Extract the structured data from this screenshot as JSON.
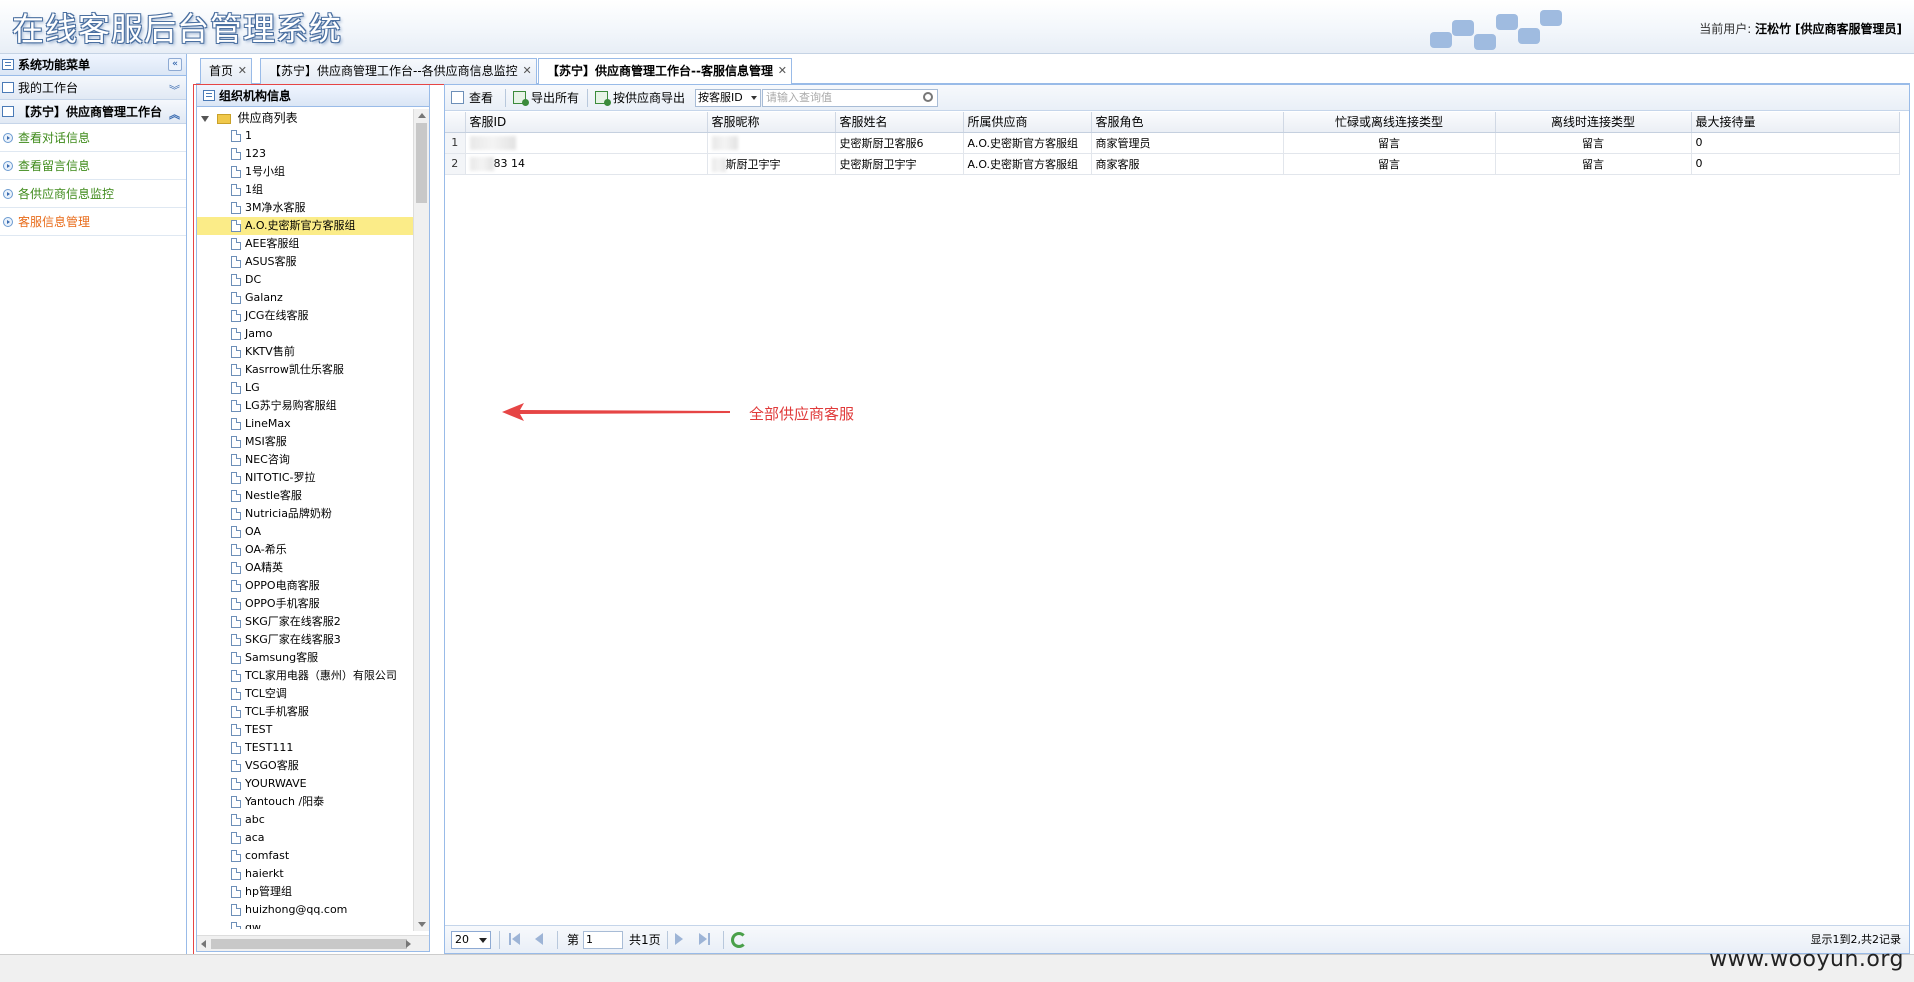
{
  "header": {
    "title": "在线客服后台管理系统",
    "user_label": "当前用户:",
    "user_name": "汪松竹",
    "user_role": "[供应商客服管理员]"
  },
  "sidebar": {
    "title": "系统功能菜单",
    "collapse_icon": "double-chevron-left-icon",
    "my_work": "我的工作台",
    "group_title": "【苏宁】供应商管理工作台",
    "items": [
      {
        "label": "查看对话信息"
      },
      {
        "label": "查看留言信息"
      },
      {
        "label": "各供应商信息监控"
      },
      {
        "label": "客服信息管理"
      }
    ]
  },
  "tabs": [
    {
      "label": "首页"
    },
    {
      "label": "【苏宁】供应商管理工作台--各供应商信息监控"
    },
    {
      "label": "【苏宁】供应商管理工作台--客服信息管理"
    }
  ],
  "org_panel": {
    "title": "组织机构信息",
    "root": "供应商列表",
    "nodes": [
      "1",
      "123",
      "1号小组",
      "1组",
      "3M净水客服",
      "A.O.史密斯官方客服组",
      "AEE客服组",
      "ASUS客服",
      "DC",
      "Galanz",
      "JCG在线客服",
      "Jamo",
      "KKTV售前",
      "Kasrrow凯仕乐客服",
      "LG",
      "LG苏宁易购客服组",
      "LineMax",
      "MSI客服",
      "NEC咨询",
      "NITOTIC-罗拉",
      "Nestle客服",
      "Nutricia品牌奶粉",
      "OA",
      "OA-希乐",
      "OA精英",
      "OPPO电商客服",
      "OPPO手机客服",
      "SKG厂家在线客服2",
      "SKG厂家在线客服3",
      "Samsung客服",
      "TCL家用电器（惠州）有限公司",
      "TCL空调",
      "TCL手机客服",
      "TEST",
      "TEST111",
      "VSGO客服",
      "YOURWAVE",
      "Yantouch /阳泰",
      "abc",
      "aca",
      "comfast",
      "haierkt",
      "hp管理组",
      "huizhong@qq.com",
      "qw"
    ],
    "selected": "A.O.史密斯官方客服组"
  },
  "toolbar": {
    "view": "查看",
    "export_all": "导出所有",
    "export_by_supplier": "按供应商导出",
    "search_field": "按客服ID",
    "search_placeholder": "请输入查询值"
  },
  "grid": {
    "columns": [
      "客服ID",
      "客服昵称",
      "客服姓名",
      "所属供应商",
      "客服角色",
      "忙碌或离线连接类型",
      "离线时连接类型",
      "最大接待量"
    ],
    "rows": [
      {
        "no": "1",
        "id": "",
        "nick": "",
        "name": "史密斯厨卫客服6",
        "supplier": "A.O.史密斯官方客服组",
        "role": "商家管理员",
        "busy": "留言",
        "offline": "留言",
        "max": "0"
      },
      {
        "no": "2",
        "id": "83  14",
        "nick": "斯厨卫宇宇",
        "name": "史密斯厨卫宇宇",
        "supplier": "A.O.史密斯官方客服组",
        "role": "商家客服",
        "busy": "留言",
        "offline": "留言",
        "max": "0"
      }
    ]
  },
  "pager": {
    "page_size": "20",
    "page_prefix": "第",
    "page_value": "1",
    "page_total": "共1页",
    "info": "显示1到2,共2记录"
  },
  "annotation": "全部供应商客服",
  "watermark": "www.wooyun.org",
  "colors": {
    "accent": "#99bbe8",
    "annotation": "#e64545",
    "menu_green": "#3e8a1a",
    "menu_active": "#e86b1a"
  }
}
